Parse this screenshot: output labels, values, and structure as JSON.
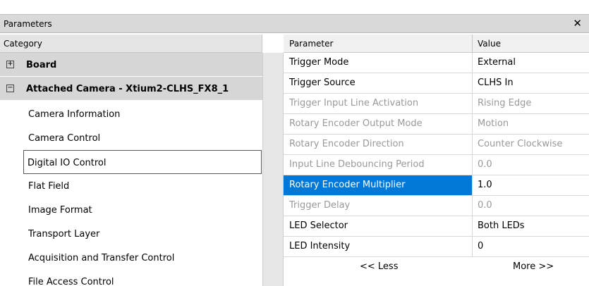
{
  "window": {
    "title": "Parameters",
    "close_glyph": "✕"
  },
  "category": {
    "header": "Category",
    "groups": [
      {
        "expander": "+",
        "label": "Board"
      },
      {
        "expander": "−",
        "label": "Attached Camera - Xtium2-CLHS_FX8_1"
      }
    ],
    "items": [
      "Camera Information",
      "Camera Control",
      "Digital IO Control",
      "Flat Field",
      "Image Format",
      "Transport Layer",
      "Acquisition and Transfer Control",
      "File Access Control"
    ],
    "selected_item": "Digital IO Control"
  },
  "grid": {
    "col_parameter": "Parameter",
    "col_value": "Value",
    "rows": [
      {
        "name": "Trigger Mode",
        "value": "External",
        "enabled": true
      },
      {
        "name": "Trigger Source",
        "value": "CLHS In",
        "enabled": true
      },
      {
        "name": "Trigger Input Line Activation",
        "value": "Rising Edge",
        "enabled": false
      },
      {
        "name": "Rotary Encoder Output Mode",
        "value": "Motion",
        "enabled": false
      },
      {
        "name": "Rotary Encoder Direction",
        "value": "Counter Clockwise",
        "enabled": false
      },
      {
        "name": "Input Line Debouncing Period",
        "value": "0.0",
        "enabled": false
      },
      {
        "name": "Rotary Encoder Multiplier",
        "value": "1.0",
        "enabled": true,
        "selected": true
      },
      {
        "name": "Trigger Delay",
        "value": "0.0",
        "enabled": false
      },
      {
        "name": "LED Selector",
        "value": "Both LEDs",
        "enabled": true
      },
      {
        "name": "LED Intensity",
        "value": "0",
        "enabled": true
      }
    ],
    "less_label": "<< Less",
    "more_label": "More >>"
  },
  "colors": {
    "selection": "#0078d7",
    "disabled_text": "#999999",
    "group_bg": "#d6d6d6"
  }
}
